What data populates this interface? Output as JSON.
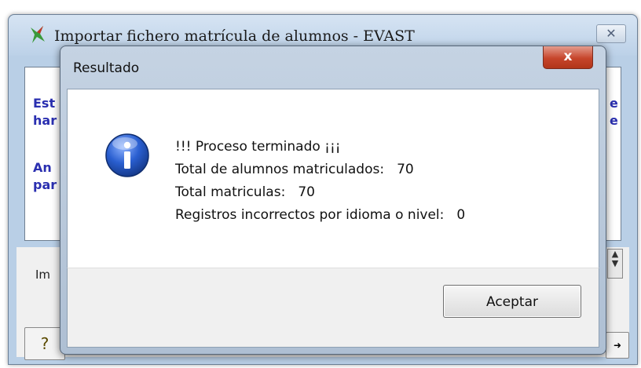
{
  "background_window": {
    "title": "Importar fichero matrícula de alumnos - EVAST",
    "panel_lines": [
      "Est",
      "har",
      "An",
      "par"
    ],
    "panel_right_fragments": [
      "e",
      "e"
    ],
    "lower_label": "Im",
    "help_glyph": "?"
  },
  "dialog": {
    "title": "Resultado",
    "close_glyph": "x",
    "icon": "info-icon",
    "message": {
      "line1": "!!! Proceso terminado ¡¡¡",
      "line2_label": "Total de alumnos matriculados:",
      "line2_value": "70",
      "line3_label": "Total matriculas:",
      "line3_value": "70",
      "line4_label": "Registros incorrectos por idioma o nivel:",
      "line4_value": "0"
    },
    "ok_label": "Aceptar"
  }
}
